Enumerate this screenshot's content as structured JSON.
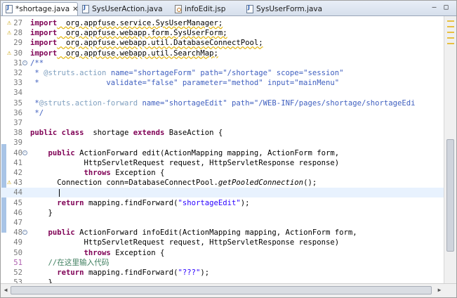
{
  "tabs": [
    {
      "label": "*shortage.java",
      "icon": "java-file-icon",
      "active": true
    },
    {
      "label": "SysUserAction.java",
      "icon": "java-file-icon",
      "active": false
    },
    {
      "label": "infoEdit.jsp",
      "icon": "jsp-file-icon",
      "active": false
    },
    {
      "label": "SysUserForm.java",
      "icon": "java-file-icon",
      "active": false
    }
  ],
  "window_controls": {
    "minimize": "–",
    "maximize": "□"
  },
  "editor": {
    "lines": [
      {
        "n": "27",
        "seg": [
          [
            "kw",
            "import"
          ],
          [
            "",
            "  org.appfuse.service.SysUserManager;"
          ]
        ]
      },
      {
        "n": "28",
        "seg": [
          [
            "kw",
            "import"
          ],
          [
            "",
            "  org.appfuse.webapp.form.SysUserForm;"
          ]
        ]
      },
      {
        "n": "29",
        "seg": [
          [
            "kw",
            "import"
          ],
          [
            "",
            "  org.appfuse.webapp.util.DatabaseConnectPool;"
          ]
        ]
      },
      {
        "n": "30",
        "seg": [
          [
            "kw",
            "import"
          ],
          [
            "",
            "  org.appfuse.webapp.util.SearchMap;"
          ]
        ]
      },
      {
        "n": "31",
        "seg": [
          [
            "cm",
            "/**"
          ]
        ]
      },
      {
        "n": "32",
        "seg": [
          [
            "cm",
            " * "
          ],
          [
            "tag",
            "@struts.action"
          ],
          [
            "cm",
            " name=\"shortageForm\" path=\"/shortage\" scope=\"session\""
          ]
        ]
      },
      {
        "n": "33",
        "seg": [
          [
            "cm",
            " *               validate=\"false\" parameter=\"method\" input=\"mainMenu\""
          ]
        ]
      },
      {
        "n": "34",
        "seg": [
          [
            "cm",
            ""
          ]
        ]
      },
      {
        "n": "35",
        "seg": [
          [
            "cm",
            " *"
          ],
          [
            "tag",
            "@struts.action-forward"
          ],
          [
            "cm",
            " name=\"shortageEdit\" path=\"/WEB-INF/pages/shortage/shortageEdi"
          ]
        ]
      },
      {
        "n": "36",
        "seg": [
          [
            "cm",
            " */"
          ]
        ]
      },
      {
        "n": "37",
        "seg": [
          [
            "",
            ""
          ]
        ]
      },
      {
        "n": "38",
        "seg": [
          [
            "kw",
            "public"
          ],
          [
            "",
            " "
          ],
          [
            "kw",
            "class"
          ],
          [
            "",
            "  shortage "
          ],
          [
            "kw",
            "extends"
          ],
          [
            "",
            " BaseAction {"
          ]
        ]
      },
      {
        "n": "39",
        "seg": [
          [
            "",
            ""
          ]
        ]
      },
      {
        "n": "40",
        "seg": [
          [
            "",
            "    "
          ],
          [
            "kw",
            "public"
          ],
          [
            "",
            " ActionForward edit(ActionMapping mapping, ActionForm form,"
          ]
        ]
      },
      {
        "n": "41",
        "seg": [
          [
            "",
            "            HttpServletRequest request, HttpServletResponse response)"
          ]
        ]
      },
      {
        "n": "42",
        "seg": [
          [
            "",
            "            "
          ],
          [
            "kw",
            "throws"
          ],
          [
            "",
            " Exception {"
          ]
        ]
      },
      {
        "n": "43",
        "seg": [
          [
            "",
            "      Connection conn=DatabaseConnectPool."
          ],
          [
            "it",
            "getPooledConnection"
          ],
          [
            "",
            "();"
          ]
        ]
      },
      {
        "n": "44",
        "seg": [
          [
            "",
            "      "
          ]
        ]
      },
      {
        "n": "45",
        "seg": [
          [
            "",
            "      "
          ],
          [
            "kw",
            "return"
          ],
          [
            "",
            " mapping.findForward("
          ],
          [
            "str",
            "\"shortageEdit\""
          ],
          [
            "",
            ");"
          ]
        ]
      },
      {
        "n": "46",
        "seg": [
          [
            "",
            "    }"
          ]
        ]
      },
      {
        "n": "47",
        "seg": [
          [
            "",
            ""
          ]
        ]
      },
      {
        "n": "48",
        "seg": [
          [
            "",
            "    "
          ],
          [
            "kw",
            "public"
          ],
          [
            "",
            " ActionForward infoEdit(ActionMapping mapping, ActionForm form,"
          ]
        ]
      },
      {
        "n": "49",
        "seg": [
          [
            "",
            "            HttpServletRequest request, HttpServletResponse response)"
          ]
        ]
      },
      {
        "n": "50",
        "seg": [
          [
            "",
            "            "
          ],
          [
            "kw",
            "throws"
          ],
          [
            "",
            " Exception {"
          ]
        ]
      },
      {
        "n": "51",
        "seg": [
          [
            "",
            "    "
          ],
          [
            "cmg",
            "//在这里输入代码"
          ]
        ]
      },
      {
        "n": "52",
        "seg": [
          [
            "",
            "      "
          ],
          [
            "kw",
            "return"
          ],
          [
            "",
            " mapping.findForward("
          ],
          [
            "str",
            "\"???\""
          ],
          [
            "",
            ");"
          ]
        ]
      },
      {
        "n": "53",
        "seg": [
          [
            "",
            "    }"
          ]
        ]
      }
    ]
  }
}
